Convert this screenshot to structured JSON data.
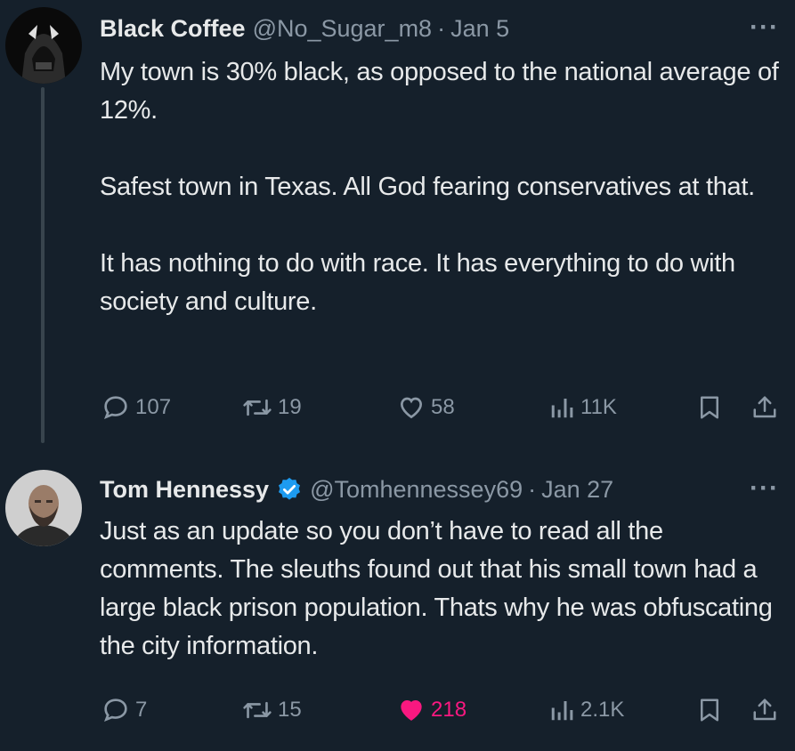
{
  "tweets": [
    {
      "author_name": "Black Coffee",
      "handle": "@No_Sugar_m8",
      "separator": "·",
      "date": "Jan 5",
      "more": "···",
      "paragraphs": [
        "My town is 30% black, as opposed to the national average of 12%.",
        "Safest town in Texas. All God fearing conservatives at that.",
        "It has nothing to do with race. It has everything to do with society and culture."
      ],
      "actions": {
        "replies": "107",
        "retweets": "19",
        "likes": "58",
        "views": "11K"
      }
    },
    {
      "author_name": "Tom Hennessy",
      "verified": true,
      "handle": "@Tomhennessey69",
      "separator": "·",
      "date": "Jan 27",
      "more": "···",
      "paragraphs": [
        "Just as an update so you don’t have to read all the comments.  The sleuths found out that his small town had a large black prison population. Thats why he was obfuscating the city information."
      ],
      "actions": {
        "replies": "7",
        "retweets": "15",
        "likes": "218",
        "views": "2.1K",
        "liked": true
      }
    }
  ],
  "icons": {
    "reply": "speech-bubble-icon",
    "retweet": "retweet-arrows-icon",
    "like": "heart-icon",
    "views": "bar-chart-icon",
    "bookmark": "bookmark-icon",
    "share": "share-upload-icon"
  },
  "colors": {
    "background": "#15202b",
    "text": "#e7e9ea",
    "muted": "#8b98a5",
    "like": "#f91880",
    "verified": "#1d9bf0"
  }
}
